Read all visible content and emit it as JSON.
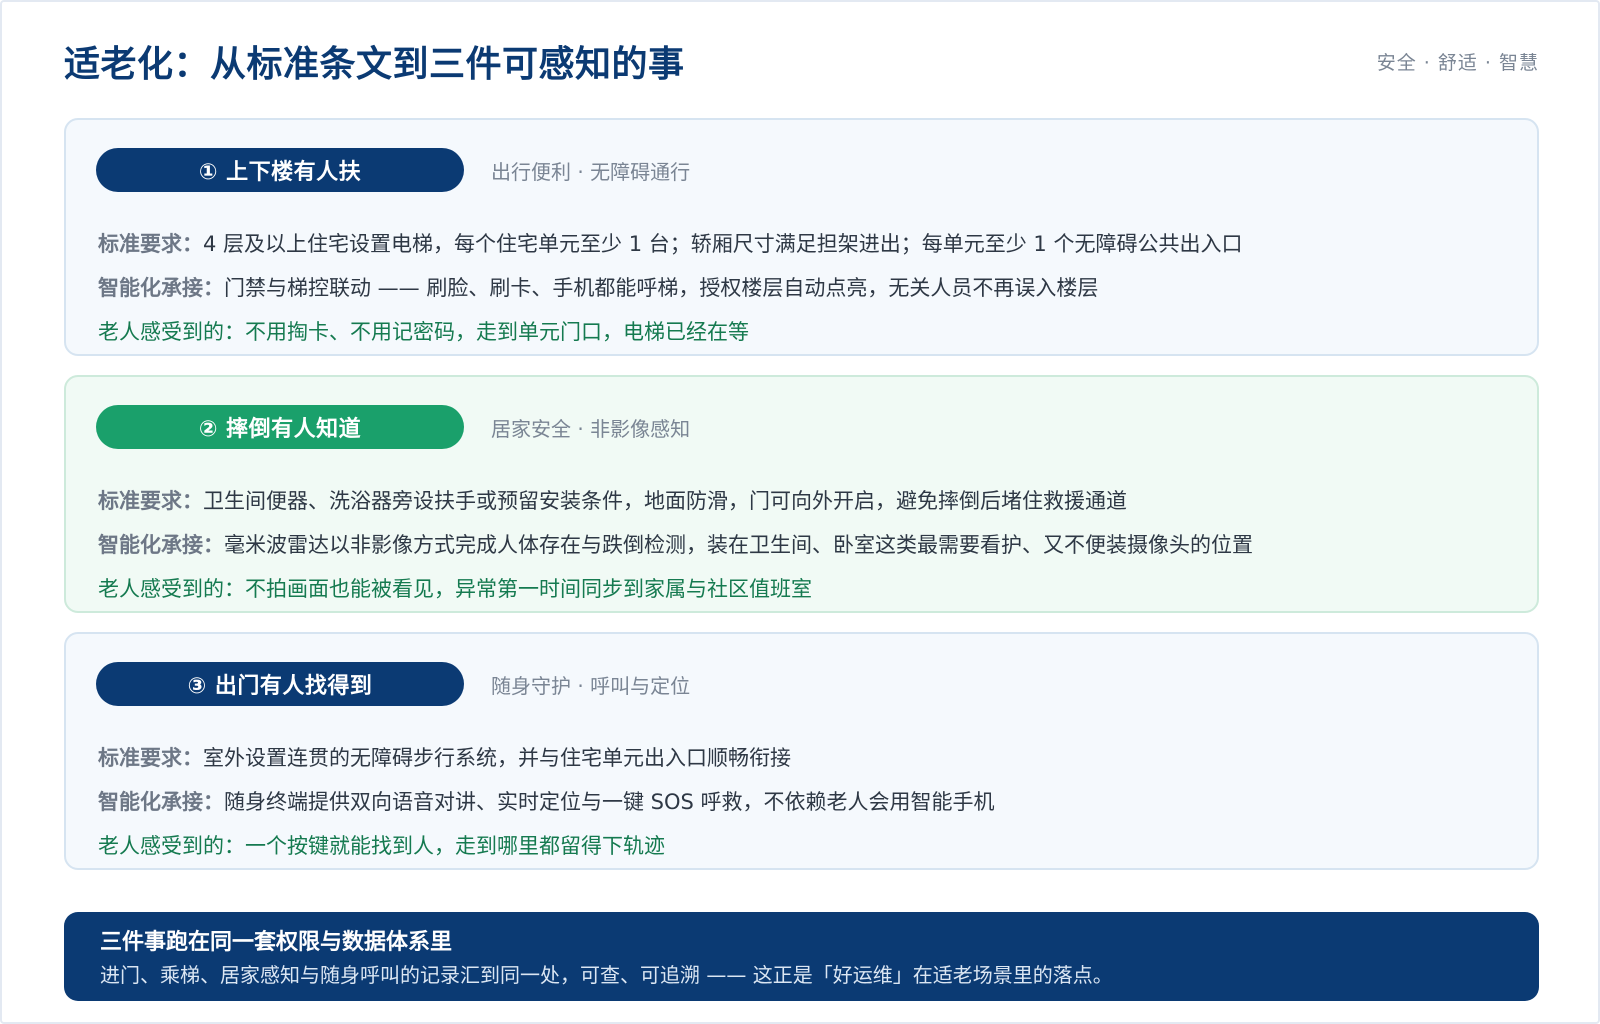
{
  "page": {
    "title": "适老化：从标准条文到三件可感知的事",
    "tags": "安全 · 舒适 · 智慧"
  },
  "cards": [
    {
      "badge": "① 上下楼有人扶",
      "subtitle": "出行便利 · 无障碍通行",
      "standard_label": "标准要求：",
      "standard_text": "4 层及以上住宅设置电梯，每个住宅单元至少 1 台；轿厢尺寸满足担架进出；每单元至少 1 个无障碍公共出入口",
      "smart_label": "智能化承接：",
      "smart_text": "门禁与梯控联动 —— 刷脸、刷卡、手机都能呼梯，授权楼层自动点亮，无关人员不再误入楼层",
      "feel_label": "老人感受到的：",
      "feel_text": "不用掏卡、不用记密码，走到单元门口，电梯已经在等"
    },
    {
      "badge": "② 摔倒有人知道",
      "subtitle": "居家安全 · 非影像感知",
      "standard_label": "标准要求：",
      "standard_text": "卫生间便器、洗浴器旁设扶手或预留安装条件，地面防滑，门可向外开启，避免摔倒后堵住救援通道",
      "smart_label": "智能化承接：",
      "smart_text": "毫米波雷达以非影像方式完成人体存在与跌倒检测，装在卫生间、卧室这类最需要看护、又不便装摄像头的位置",
      "feel_label": "老人感受到的：",
      "feel_text": "不拍画面也能被看见，异常第一时间同步到家属与社区值班室"
    },
    {
      "badge": "③ 出门有人找得到",
      "subtitle": "随身守护 · 呼叫与定位",
      "standard_label": "标准要求：",
      "standard_text": "室外设置连贯的无障碍步行系统，并与住宅单元出入口顺畅衔接",
      "smart_label": "智能化承接：",
      "smart_text": "随身终端提供双向语音对讲、实时定位与一键 SOS 呼救，不依赖老人会用智能手机",
      "feel_label": "老人感受到的：",
      "feel_text": "一个按键就能找到人，走到哪里都留得下轨迹"
    }
  ],
  "footer": {
    "title": "三件事跑在同一套权限与数据体系里",
    "text": "进门、乘梯、居家感知与随身呼叫的记录汇到同一处，可查、可追溯 —— 这正是「好运维」在适老场景里的落点。"
  },
  "colors": {
    "navy": "#0b3a73",
    "green": "#1aa06b",
    "feel_text": "#157a50",
    "muted": "#7a8594"
  }
}
